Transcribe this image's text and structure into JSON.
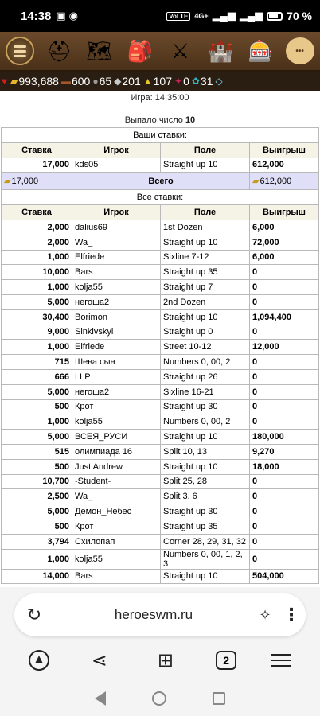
{
  "status_bar": {
    "time": "14:38",
    "network_tag": "VoLTE",
    "network_gen": "4G+",
    "battery": "70 %"
  },
  "game_nav": {
    "icons": [
      "menu-icon",
      "knight-helmet-icon",
      "map-scroll-icon",
      "bag-icon",
      "crossed-swords-icon",
      "castle-icon",
      "roulette-icon",
      "chat-icon"
    ],
    "chat_glyph": "•••"
  },
  "resources": [
    {
      "icon": "heart-icon",
      "value": "",
      "color": "#d21c1c"
    },
    {
      "icon": "gold-icon",
      "value": "993,688",
      "color": "#e7b52a"
    },
    {
      "icon": "wood-icon",
      "value": "600",
      "color": "#a5572a"
    },
    {
      "icon": "ore-icon",
      "value": "65",
      "color": "#9a9a9a"
    },
    {
      "icon": "mercury-icon",
      "value": "201",
      "color": "#c9c9c9"
    },
    {
      "icon": "sulfur-icon",
      "value": "107",
      "color": "#e6c628"
    },
    {
      "icon": "crystal-icon",
      "value": "0",
      "color": "#c8245a"
    },
    {
      "icon": "gems-icon",
      "value": "31",
      "color": "#33b5c5"
    },
    {
      "icon": "diamond-icon",
      "value": "",
      "color": "#7dd3f0"
    }
  ],
  "game": {
    "title": "Игра: 14:35:00",
    "result_label": "Выпало число",
    "result_number": "10"
  },
  "your_bets": {
    "section_title": "Ваши ставки:",
    "columns": [
      "Ставка",
      "Игрок",
      "Поле",
      "Выигрыш"
    ],
    "rows": [
      {
        "amount": "17,000",
        "player": "kds05",
        "field": "Straight up 10",
        "win": "612,000"
      }
    ],
    "total": {
      "amount": "17,000",
      "label": "Всего",
      "win": "612,000"
    }
  },
  "all_bets": {
    "section_title": "Все ставки:",
    "columns": [
      "Ставка",
      "Игрок",
      "Поле",
      "Выигрыш"
    ],
    "rows": [
      {
        "amount": "2,000",
        "player": "dalius69",
        "field": "1st Dozen",
        "win": "6,000"
      },
      {
        "amount": "2,000",
        "player": "Wa_",
        "field": "Straight up 10",
        "win": "72,000"
      },
      {
        "amount": "1,000",
        "player": "Elfriede",
        "field": "Sixline 7-12",
        "win": "6,000"
      },
      {
        "amount": "10,000",
        "player": "Bars",
        "field": "Straight up 35",
        "win": "0"
      },
      {
        "amount": "1,000",
        "player": "kolja55",
        "field": "Straight up 7",
        "win": "0"
      },
      {
        "amount": "5,000",
        "player": "негоша2",
        "field": "2nd Dozen",
        "win": "0"
      },
      {
        "amount": "30,400",
        "player": "Borimon",
        "field": "Straight up 10",
        "win": "1,094,400"
      },
      {
        "amount": "9,000",
        "player": "Sinkivskyi",
        "field": "Straight up 0",
        "win": "0"
      },
      {
        "amount": "1,000",
        "player": "Elfriede",
        "field": "Street 10-12",
        "win": "12,000"
      },
      {
        "amount": "715",
        "player": "Шева сын",
        "field": "Numbers 0, 00, 2",
        "win": "0"
      },
      {
        "amount": "666",
        "player": "LLP",
        "field": "Straight up 26",
        "win": "0"
      },
      {
        "amount": "5,000",
        "player": "негоша2",
        "field": "Sixline 16-21",
        "win": "0"
      },
      {
        "amount": "500",
        "player": "Крот",
        "field": "Straight up 30",
        "win": "0"
      },
      {
        "amount": "1,000",
        "player": "kolja55",
        "field": "Numbers 0, 00, 2",
        "win": "0"
      },
      {
        "amount": "5,000",
        "player": "ВСЕЯ_РУСИ",
        "field": "Straight up 10",
        "win": "180,000"
      },
      {
        "amount": "515",
        "player": "олимпиада 16",
        "field": "Split 10, 13",
        "win": "9,270"
      },
      {
        "amount": "500",
        "player": "Just Andrew",
        "field": "Straight up 10",
        "win": "18,000"
      },
      {
        "amount": "10,700",
        "player": "-Student-",
        "field": "Split 25, 28",
        "win": "0"
      },
      {
        "amount": "2,500",
        "player": "Wa_",
        "field": "Split 3, 6",
        "win": "0"
      },
      {
        "amount": "5,000",
        "player": "Демон_Небес",
        "field": "Straight up 30",
        "win": "0"
      },
      {
        "amount": "500",
        "player": "Крот",
        "field": "Straight up 35",
        "win": "0"
      },
      {
        "amount": "3,794",
        "player": "Схилопап",
        "field": "Corner 28, 29, 31, 32",
        "win": "0"
      },
      {
        "amount": "1,000",
        "player": "kolja55",
        "field": "Numbers 0, 00, 1, 2, 3",
        "win": "0"
      },
      {
        "amount": "14,000",
        "player": "Bars",
        "field": "Straight up 10",
        "win": "504,000"
      }
    ]
  },
  "browser": {
    "url": "heroeswm.ru",
    "tabs_count": "2"
  }
}
